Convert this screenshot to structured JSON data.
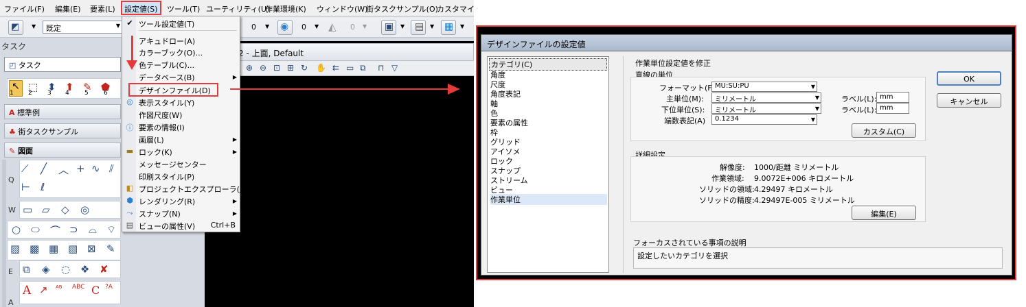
{
  "menubar": {
    "items": [
      "ファイル(F)",
      "編集(E)",
      "要素(L)",
      "設定値(S)",
      "ツール(T)",
      "ユーティリティ(U)",
      "作業環境(K)",
      "ウィンドウ(W)",
      "街タスクサンプル(O)",
      "カスタマイズ"
    ]
  },
  "toolbar": {
    "combo_value": "既定",
    "counter1": "0",
    "counter2": "0",
    "counter3": "0"
  },
  "task": {
    "label": "タスク",
    "combo_value": "タスク",
    "panel1": "標準例",
    "panel2": "街タスクサンプル",
    "panel3": "図面",
    "tool_numbers": [
      "1",
      "2",
      "3",
      "4",
      "5",
      "6"
    ],
    "side_letters": [
      "Q",
      "W",
      "E",
      "A"
    ]
  },
  "view": {
    "title": "2 - 上面, Default"
  },
  "settings_menu": {
    "items": [
      {
        "label": "ツール設定値(T)",
        "check": "✔"
      },
      {
        "label": "アキュドロー(A)"
      },
      {
        "label": "カラーブック(O)..."
      },
      {
        "label": "色テーブル(C)..."
      },
      {
        "label": "データベース(B)",
        "submenu": true
      },
      {
        "label": "デザインファイル(D)"
      },
      {
        "label": "表示スタイル(Y)"
      },
      {
        "label": "作図尺度(W)"
      },
      {
        "label": "要素の情報(I)"
      },
      {
        "label": "画層(L)",
        "submenu": true
      },
      {
        "label": "ロック(K)",
        "submenu": true
      },
      {
        "label": "メッセージセンター"
      },
      {
        "label": "印刷スタイル(P)"
      },
      {
        "label": "プロジェクトエクスプローラ(J)"
      },
      {
        "label": "レンダリング(R)",
        "submenu": true
      },
      {
        "label": "スナップ(N)",
        "submenu": true
      },
      {
        "label": "ビューの属性(V)",
        "shortcut": "Ctrl+B"
      }
    ]
  },
  "dialog": {
    "title": "デザインファイルの設定値",
    "categories": [
      "カテゴリ(C)",
      "角度",
      "尺度",
      "角度表記",
      "軸",
      "色",
      "要素の属性",
      "枠",
      "グリッド",
      "アイソメ",
      "ロック",
      "スナップ",
      "ストリーム",
      "ビュー",
      "作業単位"
    ],
    "selected_category": "作業単位",
    "section_title": "作業単位設定値を修正",
    "linear_units": {
      "heading": "直線の単位",
      "format_label": "フォーマット(F):",
      "format_value": "MU:SU:PU",
      "master_label": "主単位(M):",
      "master_value": "ミリメートル",
      "sub_label": "下位単位(S):",
      "sub_value": "ミリメートル",
      "accuracy_label": "端数表記(A)",
      "accuracy_value": "0.1234",
      "label1_caption": "ラベル(L):",
      "label1_value": "mm",
      "label2_caption": "ラベル(L):",
      "label2_value": "mm",
      "custom_button": "カスタム(C)"
    },
    "details": {
      "heading": "詳細設定",
      "rows": [
        {
          "label": "解像度:",
          "value": "1000/距離 ミリメートル"
        },
        {
          "label": "作業領域:",
          "value": "9.0072E+006 キロメートル"
        },
        {
          "label": "ソリッドの領域:",
          "value": "4.29497 キロメートル"
        },
        {
          "label": "ソリッドの精度:",
          "value": "4.29497E-005 ミリメートル"
        }
      ],
      "edit_button": "編集(E)"
    },
    "ok_button": "OK",
    "cancel_button": "キャンセル",
    "focus_heading": "フォーカスされている事項の説明",
    "focus_text": "設定したいカテゴリを選択"
  },
  "colors": {
    "highlight": "#e53a3a",
    "accent": "#274a7a"
  }
}
